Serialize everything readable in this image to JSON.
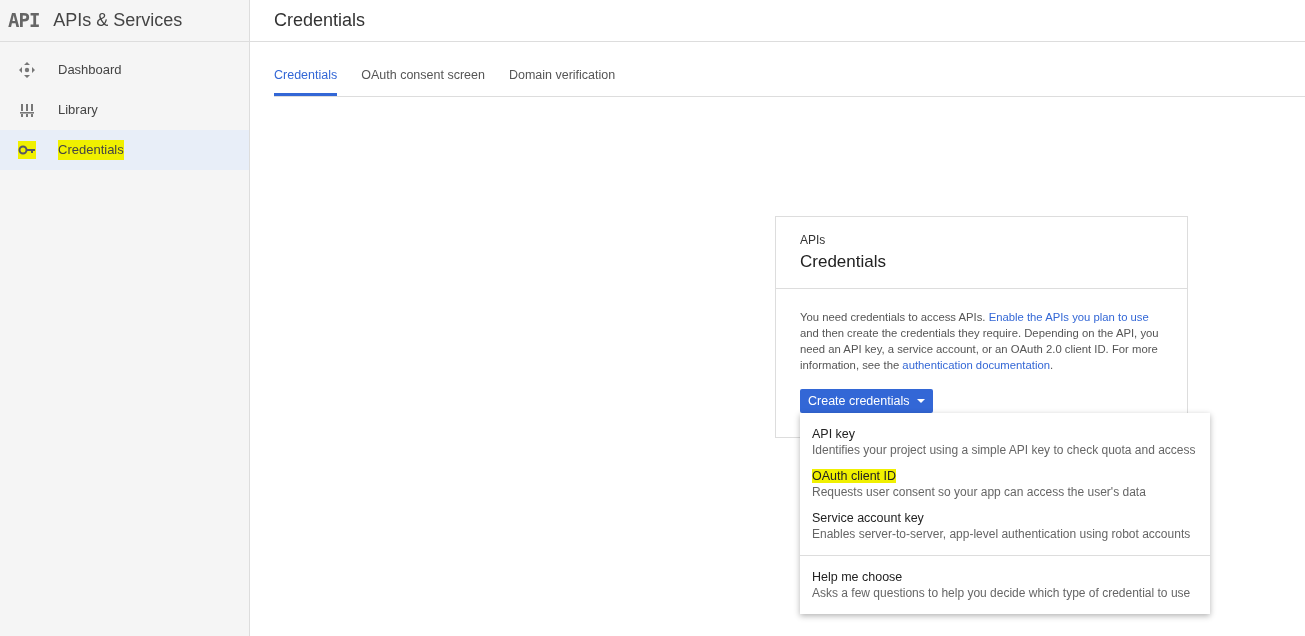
{
  "sidebar": {
    "logo": "API",
    "title": "APIs & Services",
    "items": [
      {
        "label": "Dashboard",
        "selected": false,
        "highlighted": false
      },
      {
        "label": "Library",
        "selected": false,
        "highlighted": false
      },
      {
        "label": "Credentials",
        "selected": true,
        "highlighted": true
      }
    ]
  },
  "page_title": "Credentials",
  "tabs": [
    {
      "label": "Credentials",
      "selected": true
    },
    {
      "label": "OAuth consent screen",
      "selected": false
    },
    {
      "label": "Domain verification",
      "selected": false
    }
  ],
  "card": {
    "overline": "APIs",
    "title": "Credentials",
    "body": [
      {
        "text": "You need credentials to access APIs. ",
        "link": false
      },
      {
        "text": "Enable the APIs you plan to use",
        "link": true
      },
      {
        "text": " and then create the credentials they require. Depending on the API, you need an API key, a service account, or an OAuth 2.0 client ID. For more information, see the ",
        "link": false
      },
      {
        "text": "authentication documentation",
        "link": true
      },
      {
        "text": ".",
        "link": false
      }
    ],
    "button": "Create credentials"
  },
  "menu": {
    "open": true,
    "items": [
      {
        "title": "API key",
        "description": "Identifies your project using a simple API key to check quota and access",
        "highlighted": false,
        "divider_before": false
      },
      {
        "title": "OAuth client ID",
        "description": "Requests user consent so your app can access the user's data",
        "highlighted": true,
        "divider_before": false
      },
      {
        "title": "Service account key",
        "description": "Enables server-to-server, app-level authentication using robot accounts",
        "highlighted": false,
        "divider_before": false
      },
      {
        "title": "Help me choose",
        "description": "Asks a few questions to help you decide which type of credential to use",
        "highlighted": false,
        "divider_before": true
      }
    ]
  }
}
